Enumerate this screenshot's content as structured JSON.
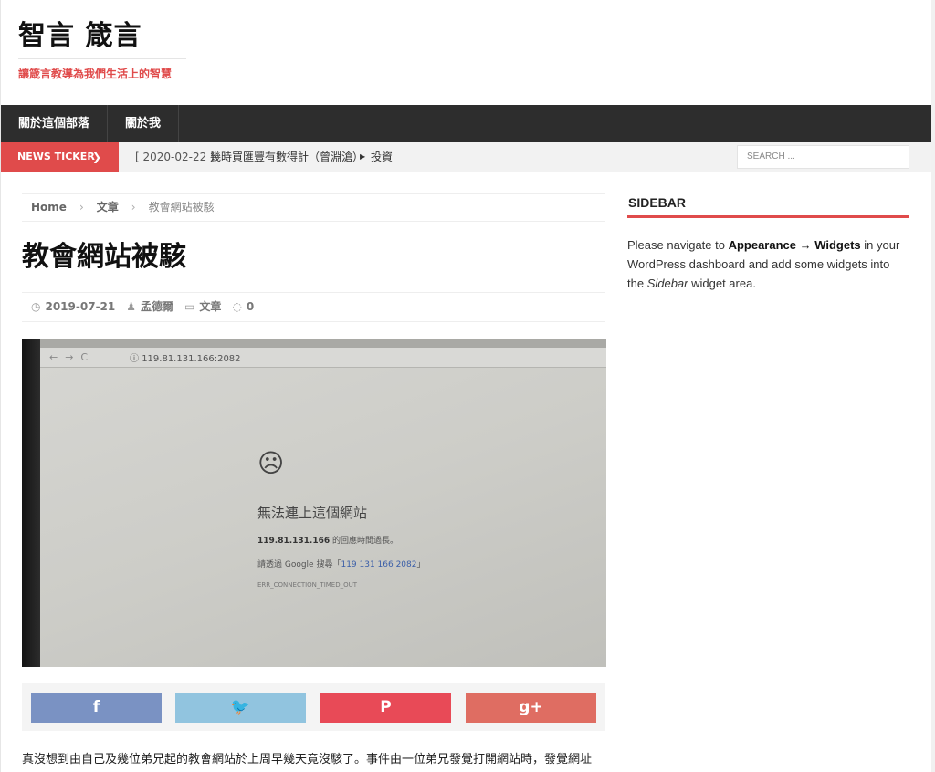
{
  "site": {
    "title": "智言 箴言",
    "tagline": "讓箴言教導為我們生活上的智慧"
  },
  "nav": {
    "items": [
      {
        "label": "關於這個部落"
      },
      {
        "label": "關於我"
      }
    ]
  },
  "ticker": {
    "label": "NEWS TICKER",
    "date": "[ 2020-02-22 ]",
    "headline": "幾時買匯豐有數得計（曾淵滄）",
    "category": "投資"
  },
  "search": {
    "placeholder": "SEARCH ..."
  },
  "breadcrumb": {
    "home": "Home",
    "category": "文章",
    "current": "教會網站被駭"
  },
  "post": {
    "title": "教會網站被駭",
    "date": "2019-07-21",
    "author": "孟德爾",
    "category": "文章",
    "comments": "0",
    "excerpt": "真沒想到由自己及幾位弟兄起的教會網站於上周早幾天竟沒駭了。事件由一位弟兄發覺打開網站時，發覺網址"
  },
  "photo": {
    "url": "119.81.131.166:2082",
    "error_title": "無法連上這個網站",
    "ip": "119.81.131.166",
    "error_line1_suffix": " 的回應時間過長。",
    "error_line2_prefix": "請透過 Google 搜尋「",
    "error_line2_link": "119 131 166 2082",
    "error_line2_suffix": "」",
    "error_code": "ERR_CONNECTION_TIMED_OUT"
  },
  "share": {
    "facebook": "f",
    "twitter": "🐦",
    "pinterest": "P",
    "googleplus": "g+"
  },
  "sidebar": {
    "title": "SIDEBAR",
    "text_1": "Please navigate to ",
    "text_bold": "Appearance → Widgets",
    "text_2": " in your WordPress dashboard and add some widgets into the ",
    "text_italic": "Sidebar",
    "text_3": " widget area."
  },
  "colors": {
    "accent": "#e04b4b",
    "nav_bg": "#2d2d2d",
    "facebook": "#7a92c3",
    "twitter": "#91c4df",
    "pinterest": "#e84a57",
    "googleplus": "#df6d62"
  },
  "icons": {
    "date": "clock-icon",
    "author": "user-icon",
    "category": "folder-icon",
    "comments": "comment-icon"
  }
}
